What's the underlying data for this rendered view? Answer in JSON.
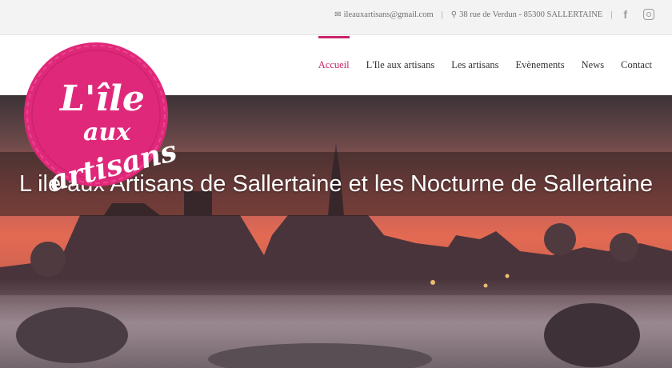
{
  "topbar": {
    "email": "ileauxartisans@gmail.com",
    "address": "38 rue de Verdun - 85300 SALLERTAINE",
    "separator": "|",
    "email_icon": "envelope-icon",
    "address_icon": "map-marker-icon",
    "social": [
      "facebook-icon",
      "instagram-icon"
    ]
  },
  "logo": {
    "line1": "L'île",
    "line2": "aux",
    "line3": "artisans"
  },
  "nav": {
    "items": [
      {
        "label": "Accueil",
        "active": true
      },
      {
        "label": "L'Ile aux artisans"
      },
      {
        "label": "Les artisans"
      },
      {
        "label": "Evènements"
      },
      {
        "label": "News"
      },
      {
        "label": "Contact"
      }
    ]
  },
  "hero": {
    "title": "L ile aux Artisans de Sallertaine et les Nocturne de Sallertaine"
  },
  "colors": {
    "accent": "#c8256a",
    "logo_pink": "#e0287a",
    "sky_top": "#3c3337",
    "sky_glow": "#e36a52"
  }
}
